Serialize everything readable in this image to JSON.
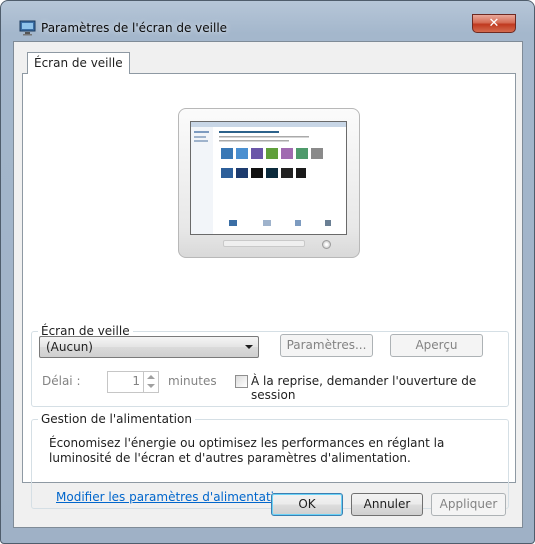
{
  "window": {
    "title": "Paramètres de l'écran de veille",
    "close_glyph": "✕"
  },
  "tabs": [
    {
      "label": "Écran de veille"
    }
  ],
  "screensaver": {
    "group_label": "Écran de veille",
    "selected": "(Aucun)",
    "settings_button": "Paramètres...",
    "preview_button": "Aperçu",
    "delay_label": "Délai :",
    "delay_value": "1",
    "minutes_label": "minutes",
    "resume_checkbox_label": "À la reprise, demander l'ouverture de session"
  },
  "power": {
    "group_label": "Gestion de l'alimentation",
    "description": "Économisez l'énergie ou optimisez les performances en réglant la luminosité de l'écran et d'autres paramètres d'alimentation.",
    "link": "Modifier les paramètres d'alimentation"
  },
  "dialog_buttons": {
    "ok": "OK",
    "cancel": "Annuler",
    "apply": "Appliquer"
  },
  "colors": {
    "accent": "#3c7fb1",
    "link": "#0066cc",
    "close": "#c0391f"
  }
}
